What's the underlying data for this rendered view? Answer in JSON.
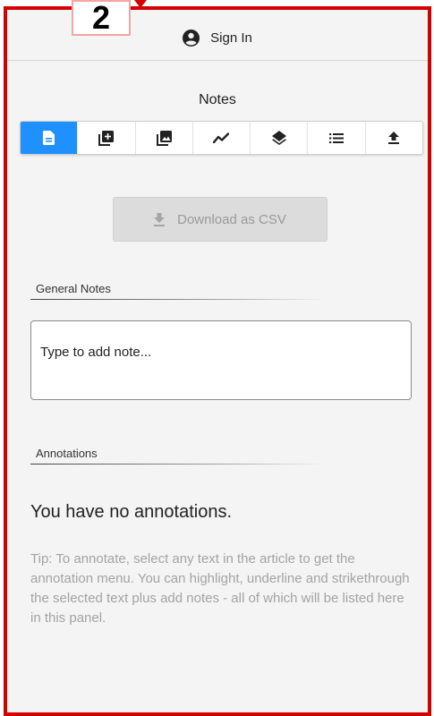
{
  "badge": {
    "number": "2"
  },
  "header": {
    "signin_label": "Sign In",
    "user_icon": "user-circle-icon"
  },
  "panel": {
    "title": "Notes"
  },
  "toolbar": {
    "active_index": 0,
    "items": [
      {
        "icon": "document-icon"
      },
      {
        "icon": "add-box-icon"
      },
      {
        "icon": "image-icon"
      },
      {
        "icon": "trend-line-icon"
      },
      {
        "icon": "layers-icon"
      },
      {
        "icon": "list-icon"
      },
      {
        "icon": "upload-icon"
      }
    ]
  },
  "download": {
    "label": "Download as CSV",
    "icon": "download-icon"
  },
  "general_notes": {
    "heading": "General Notes",
    "placeholder": "Type to add note..."
  },
  "annotations": {
    "heading": "Annotations",
    "empty_message": "You have no annotations.",
    "tip": "Tip: To annotate, select any text in the article to get the annotation menu. You can highlight, underline and strikethrough the selected text plus add notes - all of which will be listed here in this panel."
  },
  "colors": {
    "frame_border": "#d40000",
    "accent": "#1e90ff",
    "panel_bg": "#f4f4f4",
    "tip_text": "#a3a3a3"
  }
}
